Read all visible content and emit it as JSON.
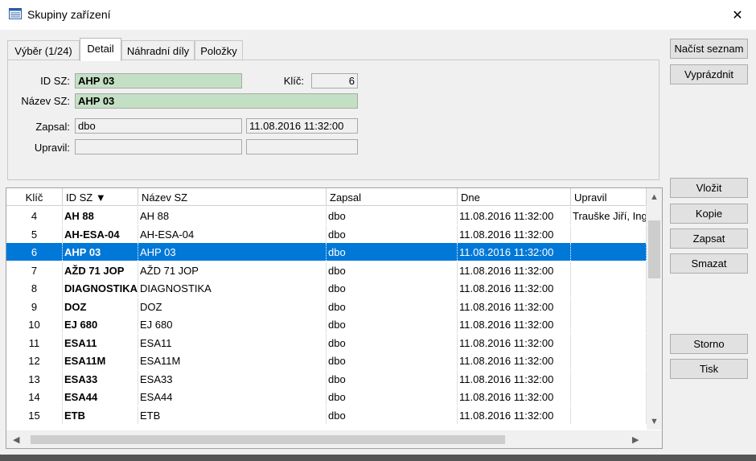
{
  "window": {
    "title": "Skupiny zařízení",
    "close": "✕"
  },
  "tabs": [
    {
      "label": "Výběr (1/24)",
      "active": false
    },
    {
      "label": "Detail",
      "active": true
    },
    {
      "label": "Náhradní díly",
      "active": false
    },
    {
      "label": "Položky",
      "active": false
    }
  ],
  "detail": {
    "id_label": "ID SZ:",
    "id_value": "AHP 03",
    "key_label": "Klíč:",
    "key_value": "6",
    "name_label": "Název SZ:",
    "name_value": "AHP 03",
    "created_label": "Zapsal:",
    "created_by": "dbo",
    "created_at": "11.08.2016 11:32:00",
    "edited_label": "Upravil:",
    "edited_by": "",
    "edited_at": ""
  },
  "buttons": {
    "load": "Načíst seznam",
    "clear": "Vyprázdnit",
    "insert": "Vložit",
    "copy": "Kopie",
    "write": "Zapsat",
    "delete": "Smazat",
    "cancel": "Storno",
    "print": "Tisk"
  },
  "grid": {
    "columns": [
      "Klíč",
      "ID SZ ▼",
      "Název SZ",
      "Zapsal",
      "Dne",
      "Upravil"
    ],
    "rows": [
      {
        "key": "4",
        "id": "AH 88",
        "name": "AH 88",
        "by": "dbo",
        "date": "11.08.2016 11:32:00",
        "edited": "Trauške Jiří, Ing",
        "selected": false
      },
      {
        "key": "5",
        "id": "AH-ESA-04",
        "name": "AH-ESA-04",
        "by": "dbo",
        "date": "11.08.2016 11:32:00",
        "edited": "",
        "selected": false
      },
      {
        "key": "6",
        "id": "AHP 03",
        "name": "AHP 03",
        "by": "dbo",
        "date": "11.08.2016 11:32:00",
        "edited": "",
        "selected": true
      },
      {
        "key": "7",
        "id": "AŽD 71 JOP",
        "name": "AŽD 71 JOP",
        "by": "dbo",
        "date": "11.08.2016 11:32:00",
        "edited": "",
        "selected": false
      },
      {
        "key": "8",
        "id": "DIAGNOSTIKA",
        "name": "DIAGNOSTIKA",
        "by": "dbo",
        "date": "11.08.2016 11:32:00",
        "edited": "",
        "selected": false
      },
      {
        "key": "9",
        "id": "DOZ",
        "name": "DOZ",
        "by": "dbo",
        "date": "11.08.2016 11:32:00",
        "edited": "",
        "selected": false
      },
      {
        "key": "10",
        "id": "EJ 680",
        "name": "EJ 680",
        "by": "dbo",
        "date": "11.08.2016 11:32:00",
        "edited": "",
        "selected": false
      },
      {
        "key": "11",
        "id": "ESA11",
        "name": "ESA11",
        "by": "dbo",
        "date": "11.08.2016 11:32:00",
        "edited": "",
        "selected": false
      },
      {
        "key": "12",
        "id": "ESA11M",
        "name": "ESA11M",
        "by": "dbo",
        "date": "11.08.2016 11:32:00",
        "edited": "",
        "selected": false
      },
      {
        "key": "13",
        "id": "ESA33",
        "name": "ESA33",
        "by": "dbo",
        "date": "11.08.2016 11:32:00",
        "edited": "",
        "selected": false
      },
      {
        "key": "14",
        "id": "ESA44",
        "name": "ESA44",
        "by": "dbo",
        "date": "11.08.2016 11:32:00",
        "edited": "",
        "selected": false
      },
      {
        "key": "15",
        "id": "ETB",
        "name": "ETB",
        "by": "dbo",
        "date": "11.08.2016 11:32:00",
        "edited": "",
        "selected": false
      }
    ]
  },
  "icons": {
    "app": "table-window-icon",
    "up": "▲",
    "down": "▼",
    "left": "◀",
    "right": "▶"
  },
  "colors": {
    "selection": "#0078d7",
    "field_highlight": "#c4e0c4"
  }
}
